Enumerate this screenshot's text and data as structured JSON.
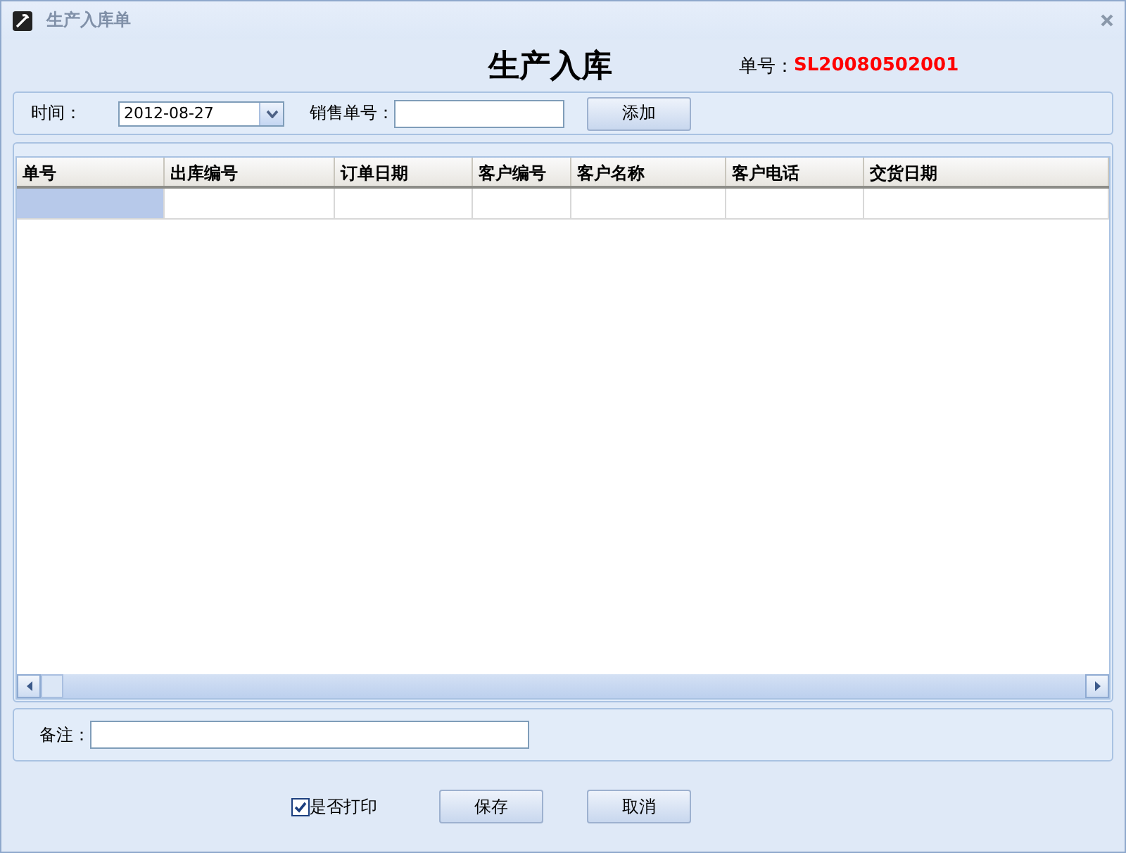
{
  "window": {
    "title": "生产入库单"
  },
  "heading": "生产入库",
  "order_number": {
    "label": "单号：",
    "value": "SL20080502001"
  },
  "filter": {
    "time_label": "时间：",
    "date_value": "2012-08-27",
    "sales_label": "销售单号：",
    "add_button": "添加"
  },
  "table": {
    "columns": [
      "单号",
      "出库编号",
      "订单日期",
      "客户编号",
      "客户名称",
      "客户电话",
      "交货日期"
    ],
    "rows": [
      {
        "selected": true
      }
    ]
  },
  "remark": {
    "label": "备注："
  },
  "print_option": {
    "label": "是否打印",
    "checked": true
  },
  "buttons": [
    "保存",
    "取消"
  ]
}
